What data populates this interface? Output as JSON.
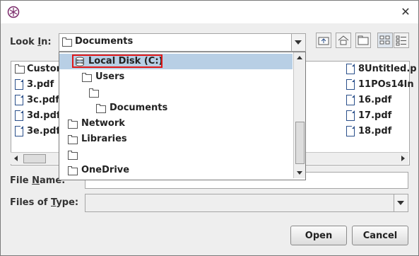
{
  "titlebar": {
    "close_glyph": "✕"
  },
  "look_in": {
    "label_pre": "Look ",
    "label_u": "I",
    "label_post": "n:",
    "value": "Documents"
  },
  "toolbar": {
    "icons": [
      "up-one-level-icon",
      "home-icon",
      "new-folder-icon",
      "list-view-icon",
      "details-view-icon"
    ]
  },
  "dropdown": {
    "items": [
      {
        "label": "Local Disk (C:)",
        "icon": "disk-icon",
        "selected": true
      },
      {
        "label": "Users",
        "icon": "folder-icon"
      },
      {
        "label": "",
        "icon": "folder-icon"
      },
      {
        "label": "Documents",
        "icon": "folder-icon"
      },
      {
        "label": "Network",
        "icon": "folder-icon"
      },
      {
        "label": "Libraries",
        "icon": "folder-icon"
      },
      {
        "label": "",
        "icon": "folder-icon"
      },
      {
        "label": "OneDrive",
        "icon": "folder-icon"
      }
    ]
  },
  "files": {
    "left": [
      "Custor",
      "3.pdf",
      "3c.pdf",
      "3d.pdf",
      "3e.pdf"
    ],
    "right": [
      "8Untitled.p",
      "11POs14In",
      "16.pdf",
      "17.pdf",
      "18.pdf"
    ]
  },
  "file_name": {
    "label_pre": "File ",
    "label_u": "N",
    "label_post": "ame:",
    "value": ""
  },
  "files_of_type": {
    "label_pre": "Files of ",
    "label_u": "T",
    "label_post": "ype:",
    "value": ""
  },
  "buttons": {
    "open": "Open",
    "cancel": "Cancel"
  }
}
